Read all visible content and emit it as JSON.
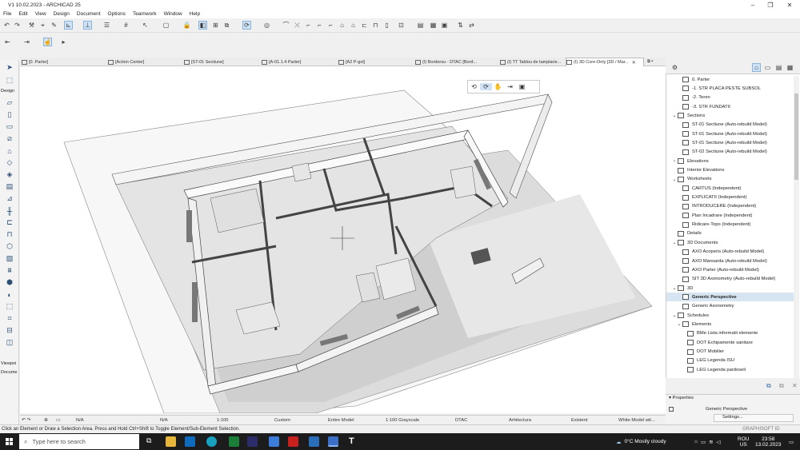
{
  "window": {
    "title": "V1 10.02.2023 - ARCHICAD 25"
  },
  "menu": [
    "File",
    "Edit",
    "View",
    "Design",
    "Document",
    "Options",
    "Teamwork",
    "Window",
    "Help"
  ],
  "tabs": [
    {
      "label": "[0. Parter]"
    },
    {
      "label": "[Action Center]"
    },
    {
      "label": "[ST-01 Sectiune]"
    },
    {
      "label": "[A-01.1.4 Parter]"
    },
    {
      "label": "[A2 P-gol]"
    },
    {
      "label": "(I) Borderou - DTAC [Bord..."
    },
    {
      "label": "(I) TT Tablou de tamplarie..."
    },
    {
      "label": "(I) 3D Core-Only [3D / Mar..."
    }
  ],
  "toolbox": {
    "design_label": "Design",
    "viewpoint_label": "Viewpoi",
    "document_label": "Docume"
  },
  "navigator": {
    "items": [
      {
        "label": "0. Parter",
        "indent": 2,
        "chev": ""
      },
      {
        "label": "-1. STR PLACA PESTE SUBSOL",
        "indent": 2,
        "chev": ""
      },
      {
        "label": "-2. Teren",
        "indent": 2,
        "chev": ""
      },
      {
        "label": "-3. STR FUNDATII",
        "indent": 2,
        "chev": ""
      },
      {
        "label": "Sections",
        "indent": 1,
        "chev": "v"
      },
      {
        "label": "ST-01 Sectiune (Auto-rebuild Model)",
        "indent": 2,
        "chev": ""
      },
      {
        "label": "ST-01 Sectiune (Auto-rebuild Model)",
        "indent": 2,
        "chev": ""
      },
      {
        "label": "ST-01 Sectiune (Auto-rebuild Model)",
        "indent": 2,
        "chev": ""
      },
      {
        "label": "ST-02 Sectiune (Auto-rebuild Model)",
        "indent": 2,
        "chev": ""
      },
      {
        "label": "Elevations",
        "indent": 1,
        "chev": ">"
      },
      {
        "label": "Interior Elevations",
        "indent": 1,
        "chev": ""
      },
      {
        "label": "Worksheets",
        "indent": 1,
        "chev": "v"
      },
      {
        "label": "CARTUS (Independent)",
        "indent": 2,
        "chev": ""
      },
      {
        "label": "EXPLICATII (Independent)",
        "indent": 2,
        "chev": ""
      },
      {
        "label": "INTRODUCERE (Independent)",
        "indent": 2,
        "chev": ""
      },
      {
        "label": "Plan Incadrare (Independent)",
        "indent": 2,
        "chev": ""
      },
      {
        "label": "Ridicare-Topo (Independent)",
        "indent": 2,
        "chev": ""
      },
      {
        "label": "Details",
        "indent": 1,
        "chev": ""
      },
      {
        "label": "3D Documents",
        "indent": 1,
        "chev": "v"
      },
      {
        "label": "AXO Acoperis (Auto-rebuild Model)",
        "indent": 2,
        "chev": ""
      },
      {
        "label": "AXO Mansarda (Auto-rebuild Model)",
        "indent": 2,
        "chev": ""
      },
      {
        "label": "AXO Parter (Auto-rebuild Model)",
        "indent": 2,
        "chev": ""
      },
      {
        "label": "SIT 3D Axonometry (Auto-rebuild Model)",
        "indent": 2,
        "chev": ""
      },
      {
        "label": "3D",
        "indent": 1,
        "chev": "v"
      },
      {
        "label": "Generic Perspective",
        "indent": 2,
        "chev": "",
        "selected": true
      },
      {
        "label": "Generic Axonometry",
        "indent": 2,
        "chev": ""
      },
      {
        "label": "Schedules",
        "indent": 1,
        "chev": "v"
      },
      {
        "label": "Elements",
        "indent": 2,
        "chev": "v"
      },
      {
        "label": "BMe Lista informatii elemente",
        "indent": 3,
        "chev": ""
      },
      {
        "label": "DOT Echipamente sanitare",
        "indent": 3,
        "chev": ""
      },
      {
        "label": "DOT Mobilier",
        "indent": 3,
        "chev": ""
      },
      {
        "label": "LEG Legenda ISU",
        "indent": 3,
        "chev": ""
      },
      {
        "label": "LEG Legenda pardoseli",
        "indent": 3,
        "chev": ""
      }
    ],
    "properties_label": "Properties",
    "properties_value": "Generic Perspective",
    "settings_label": "Settings..."
  },
  "viewport_status": {
    "na1": "N/A",
    "na2": "N/A",
    "scale": "1:100",
    "custom": "Custom",
    "model": "Entire Model",
    "pen": "1:100 Grayscale",
    "dtac": "DTAC",
    "arch": "Arhitectura",
    "existent": "Existent",
    "white": "White Model wit..."
  },
  "status_message": "Click an Element or Draw a Selection Area. Press and Hold Ctrl+Shift to Toggle Element/Sub-Element Selection.",
  "graphisoft": "GRAPHISOFT ID",
  "taskbar": {
    "search_placeholder": "Type here to search",
    "weather": "0°C  Mostly cloudy",
    "lang_top": "ROU",
    "lang_bottom": "US",
    "time": "23:58",
    "date": "13.02.2023"
  }
}
